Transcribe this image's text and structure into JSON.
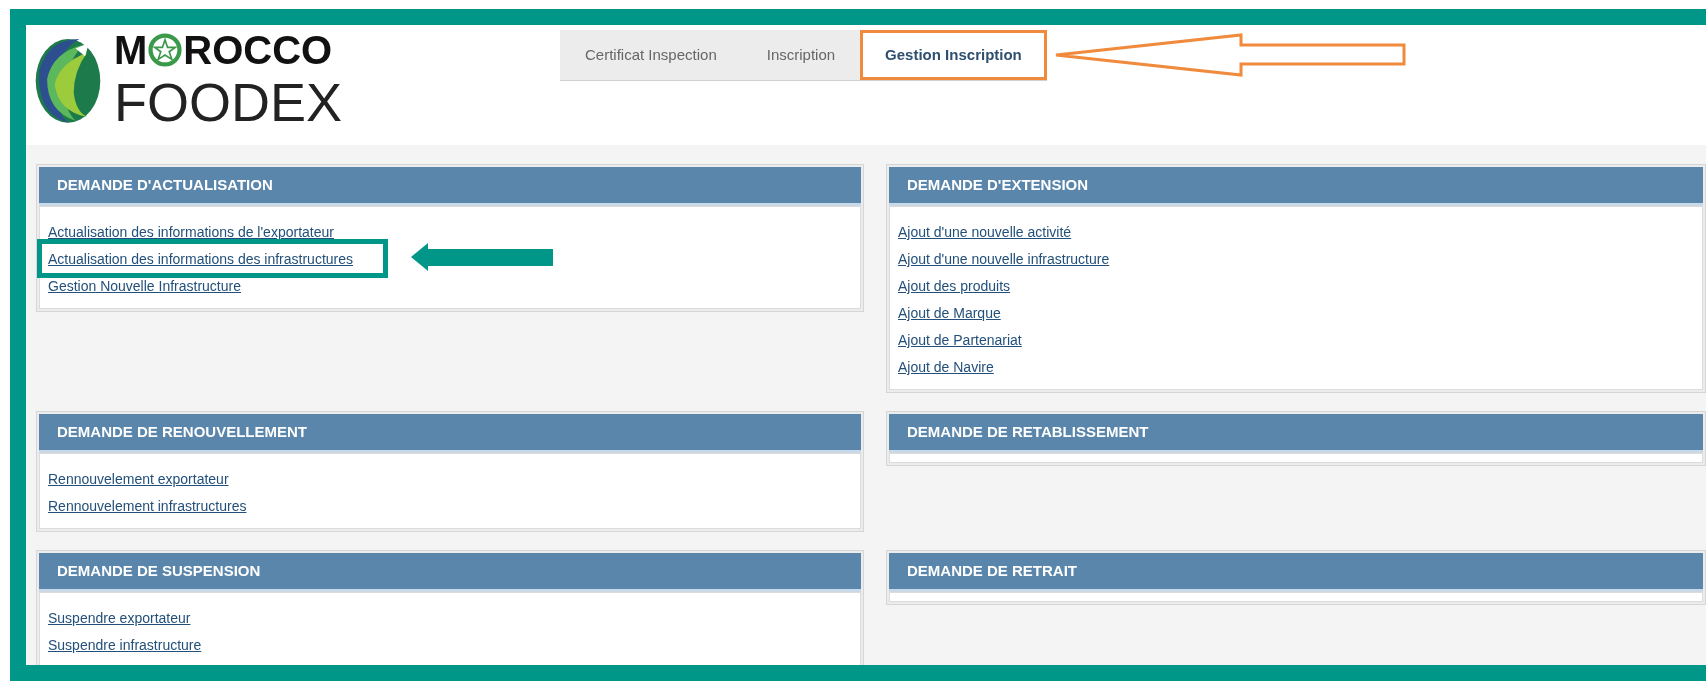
{
  "logo": {
    "text_before_emblem": "M",
    "text_after_emblem": "ROCCO",
    "subtitle": "FOODEX"
  },
  "tabs": [
    {
      "label": "Certificat Inspection",
      "selected": false,
      "highlighted": false
    },
    {
      "label": "Inscription",
      "selected": false,
      "highlighted": false
    },
    {
      "label": "Gestion Inscription",
      "selected": true,
      "highlighted": true
    }
  ],
  "panels": [
    {
      "title": "DEMANDE D'ACTUALISATION",
      "links": [
        {
          "label": "Actualisation des informations de l'exportateur",
          "highlighted": false
        },
        {
          "label": "Actualisation des informations des infrastructures",
          "highlighted": true
        },
        {
          "label": "Gestion Nouvelle Infrastructure",
          "highlighted": false
        }
      ]
    },
    {
      "title": "DEMANDE D'EXTENSION",
      "links": [
        {
          "label": "Ajout d'une nouvelle activité",
          "highlighted": false
        },
        {
          "label": "Ajout d'une nouvelle infrastructure",
          "highlighted": false
        },
        {
          "label": "Ajout des produits",
          "highlighted": false
        },
        {
          "label": "Ajout de Marque",
          "highlighted": false
        },
        {
          "label": "Ajout de Partenariat",
          "highlighted": false
        },
        {
          "label": "Ajout de Navire",
          "highlighted": false
        }
      ]
    },
    {
      "title": "DEMANDE DE RENOUVELLEMENT",
      "links": [
        {
          "label": "Rennouvelement exportateur",
          "highlighted": false
        },
        {
          "label": "Rennouvelement infrastructures",
          "highlighted": false
        }
      ]
    },
    {
      "title": "DEMANDE DE RETABLISSEMENT"
    },
    {
      "title": "DEMANDE DE SUSPENSION",
      "links": [
        {
          "label": "Suspendre exportateur",
          "highlighted": false
        },
        {
          "label": "Suspendre infrastructure",
          "highlighted": false
        }
      ]
    },
    {
      "title": "DEMANDE DE RETRAIT"
    }
  ]
}
